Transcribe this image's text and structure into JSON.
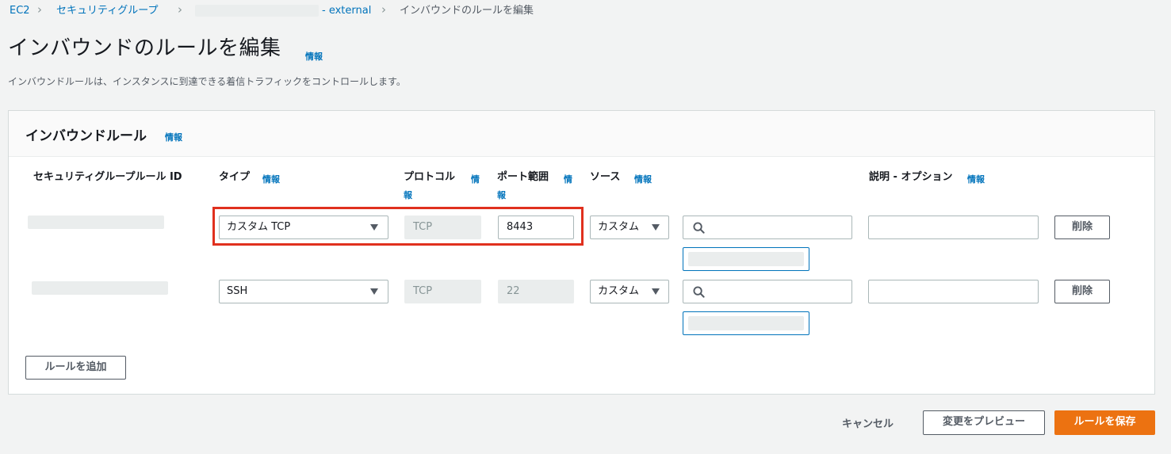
{
  "breadcrumb": {
    "ec2": "EC2",
    "security_groups": "セキュリティグループ",
    "sg_name_suffix": "- external",
    "current": "インバウンドのルールを編集"
  },
  "header": {
    "title": "インバウンドのルールを編集",
    "info": "情報",
    "description": "インバウンドルールは、インスタンスに到達できる着信トラフィックをコントロールします。"
  },
  "panel": {
    "title": "インバウンドルール",
    "info": "情報",
    "columns": {
      "rule_id": "セキュリティグループルール ID",
      "type": "タイプ",
      "protocol": "プロトコル",
      "port_range": "ポート範囲",
      "source": "ソース",
      "description": "説明 - オプション",
      "info": "情報",
      "info_wrap_1": "情",
      "info_wrap_2": "報"
    },
    "rules": [
      {
        "type": "カスタム TCP",
        "protocol": "TCP",
        "port_range": "8443",
        "source": "カスタム",
        "search": "",
        "description": "",
        "delete": "削除"
      },
      {
        "type": "SSH",
        "protocol": "TCP",
        "port_range": "22",
        "source": "カスタム",
        "search": "",
        "description": "",
        "delete": "削除"
      }
    ],
    "add_rule": "ルールを追加"
  },
  "footer": {
    "cancel": "キャンセル",
    "preview": "変更をプレビュー",
    "save": "ルールを保存"
  },
  "colors": {
    "link": "#0073bb",
    "primary": "#ec7211",
    "highlight": "#e0301e"
  }
}
